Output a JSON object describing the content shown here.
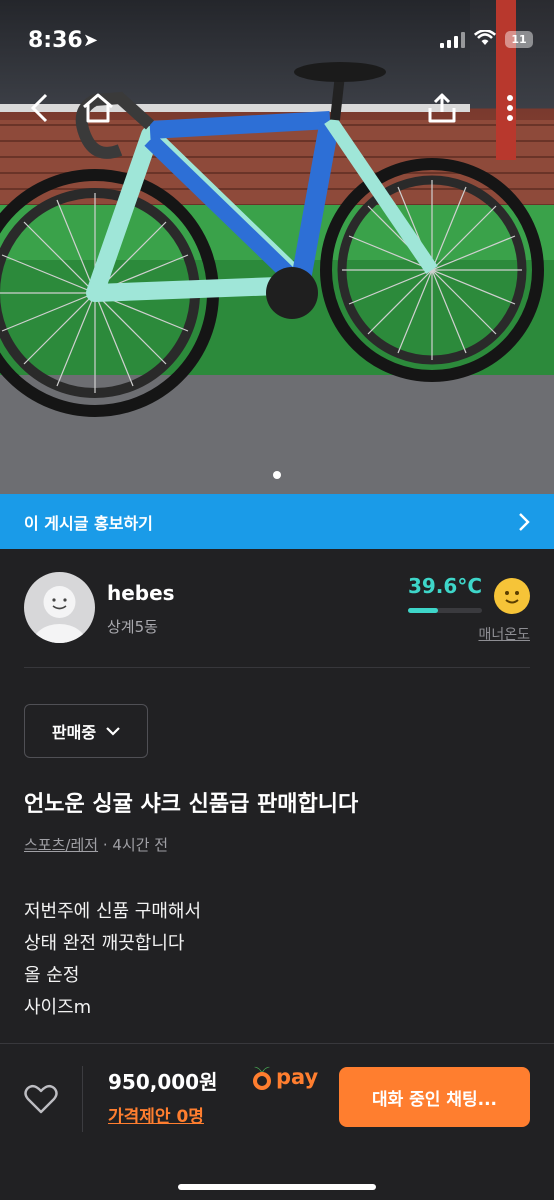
{
  "status_bar": {
    "time": "8:36",
    "battery": "11"
  },
  "icons": {
    "location": "location-arrow-icon",
    "signal": "cellular-signal-icon",
    "wifi": "wifi-icon",
    "battery": "battery-icon",
    "back": "chevron-left-icon",
    "home": "home-icon",
    "share": "share-icon",
    "more": "more-vertical-icon",
    "promo_arrow": "chevron-right-icon",
    "status_dropdown": "chevron-down-icon",
    "like": "heart-icon",
    "pay_logo": "carrot-icon",
    "manner_face": "smiley-face-icon"
  },
  "gallery": {
    "page_count": 1,
    "active_index": 0
  },
  "promo": {
    "label": "이 게시글 홍보하기"
  },
  "seller": {
    "name": "hebes",
    "location": "상계5동",
    "temperature": "39.6°C",
    "temperature_level": 0.4,
    "manner_label": "매너온도"
  },
  "listing": {
    "status": "판매중",
    "title": "언노운 싱귤 샤크 신품급 판매합니다",
    "category": "스포츠/레저",
    "posted": "· 4시간 전",
    "description": [
      "저번주에 신품 구매해서",
      "상태 완전 깨끗합니다",
      "올 순정",
      "사이즈m"
    ]
  },
  "bottom_bar": {
    "price": "950,000원",
    "pay_label": "pay",
    "offer_label": "가격제안 0명",
    "chat_button": "대화 중인 채팅..."
  },
  "colors": {
    "background": "#212123",
    "promo": "#1a9be8",
    "accent": "#ff7e2f",
    "temperature": "#3ed6c9"
  }
}
